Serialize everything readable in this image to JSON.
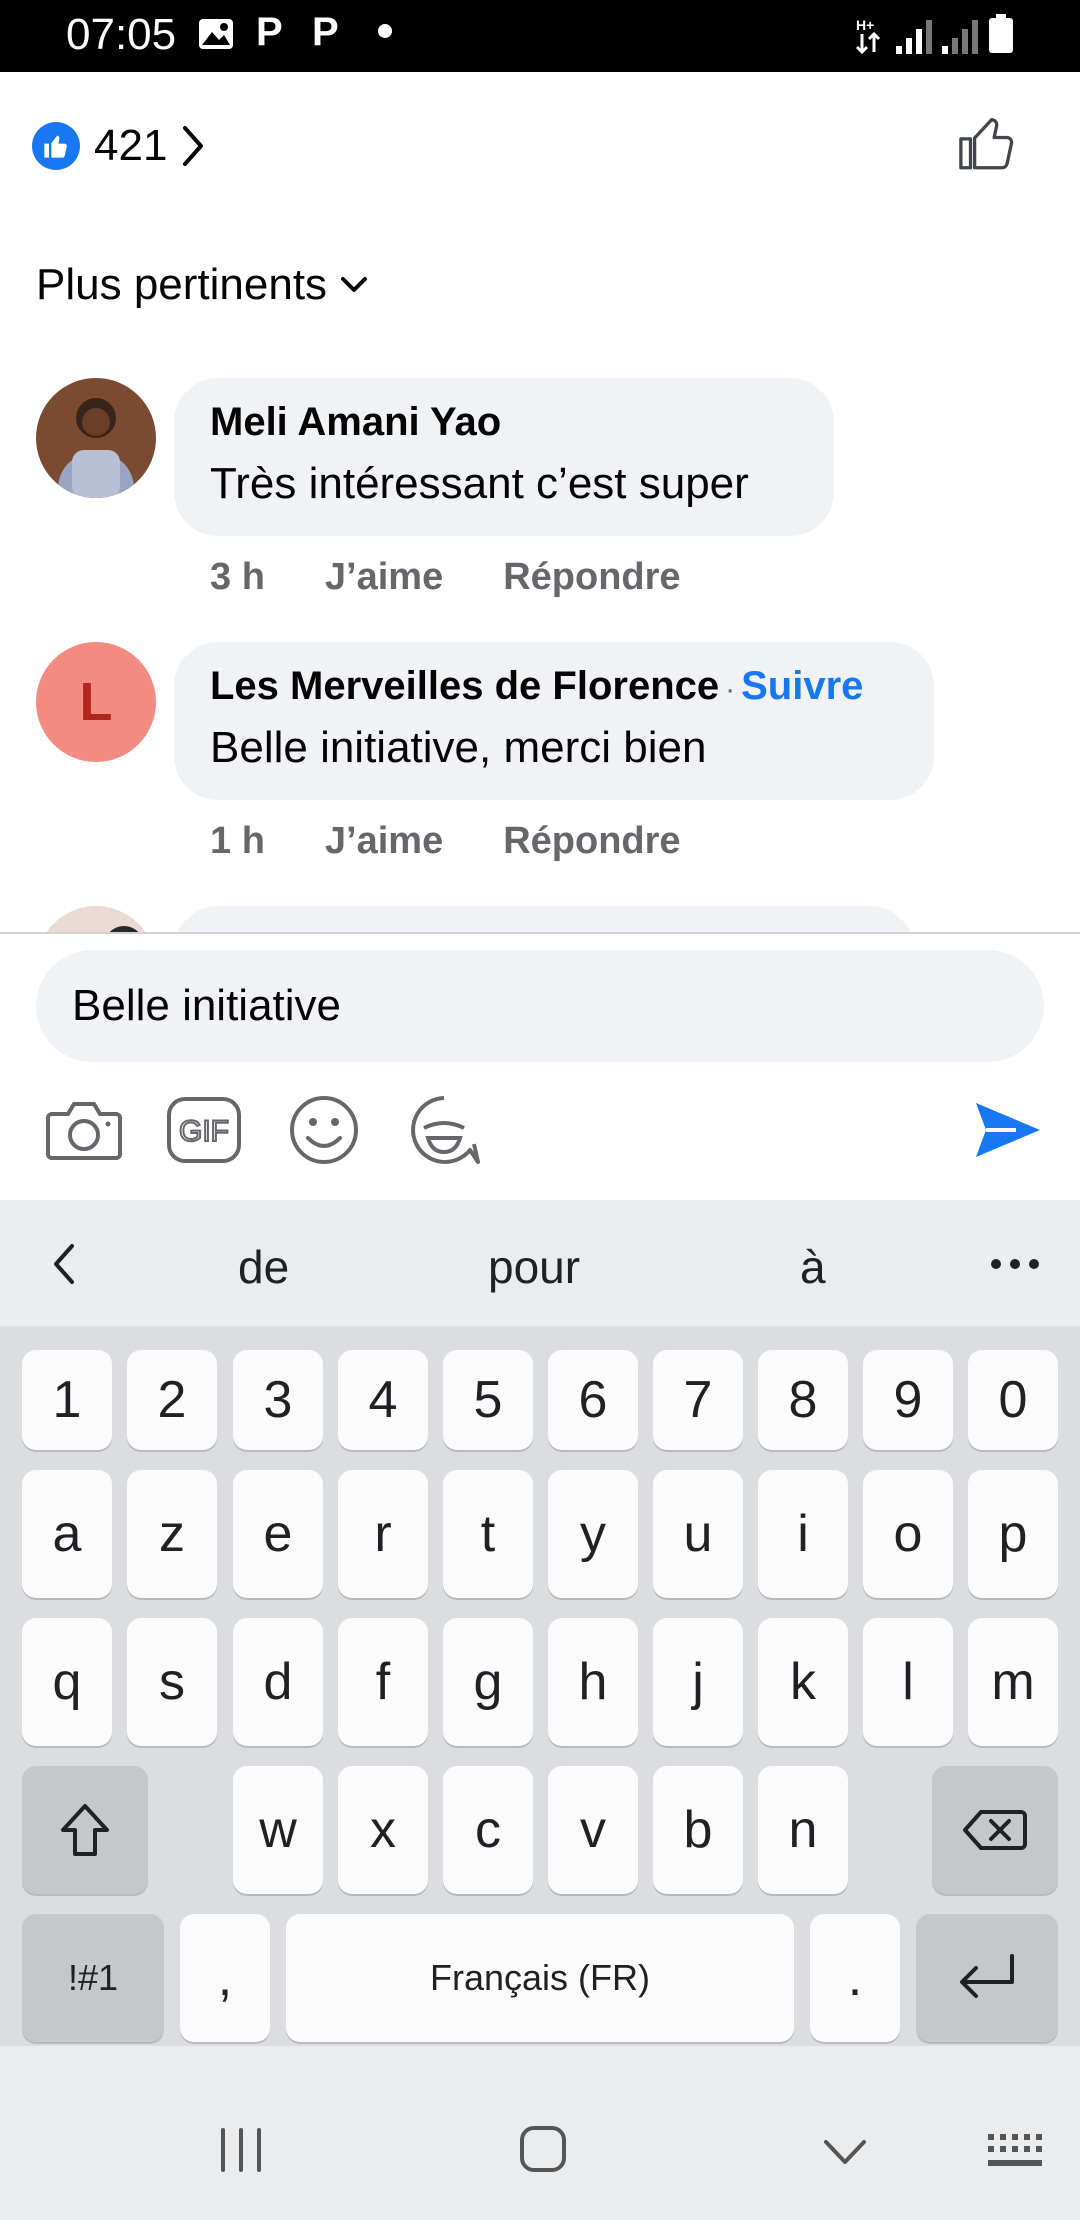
{
  "status_bar": {
    "time": "07:05",
    "p1": "P",
    "p2": "P"
  },
  "reactions": {
    "count": "421"
  },
  "sort": {
    "label": "Plus pertinents"
  },
  "comments": [
    {
      "name": "Meli Amani Yao",
      "text": "Très intéressant c’est super",
      "time": "3 h",
      "like": "J’aime",
      "reply": "Répondre"
    },
    {
      "name": "Les Merveilles de Florence",
      "follow": "Suivre",
      "text": "Belle initiative, merci bien",
      "time": "1 h",
      "like": "J’aime",
      "reply": "Répondre",
      "avatar_letter": "L"
    }
  ],
  "composer": {
    "value": "Belle initiative",
    "gif_label": "GIF"
  },
  "keyboard": {
    "suggestions": [
      "de",
      "pour",
      "à"
    ],
    "row_numbers": [
      "1",
      "2",
      "3",
      "4",
      "5",
      "6",
      "7",
      "8",
      "9",
      "0"
    ],
    "row1": [
      "a",
      "z",
      "e",
      "r",
      "t",
      "y",
      "u",
      "i",
      "o",
      "p"
    ],
    "row2": [
      "q",
      "s",
      "d",
      "f",
      "g",
      "h",
      "j",
      "k",
      "l",
      "m"
    ],
    "row3": [
      "w",
      "x",
      "c",
      "v",
      "b",
      "n"
    ],
    "symbols_key": "!#1",
    "comma": ",",
    "space": "Français (FR)",
    "period": "."
  },
  "colors": {
    "accent": "#1877f2",
    "avatar_red": "#f28b82",
    "avatar_letter": "#b3261e"
  }
}
